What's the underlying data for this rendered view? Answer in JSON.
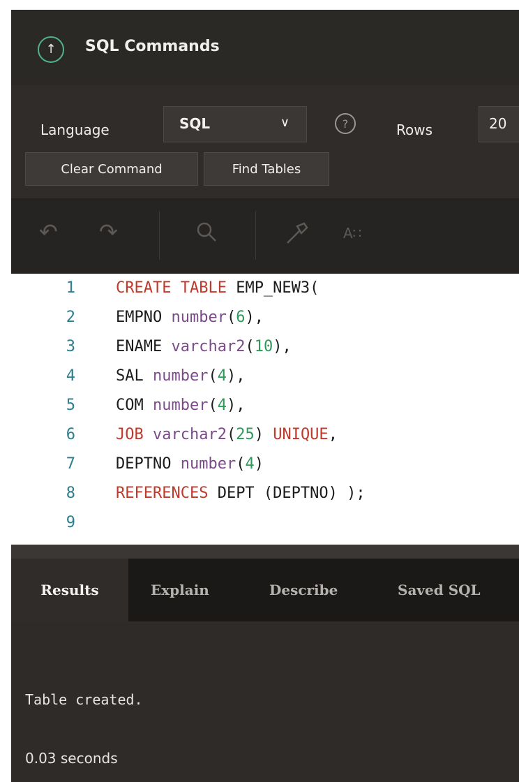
{
  "header": {
    "title": "SQL Commands",
    "icon": "arrow-up-circle-icon"
  },
  "toolbar": {
    "language_label": "Language",
    "language_value": "SQL",
    "rows_label": "Rows",
    "rows_value": "20",
    "clear_label": "Clear Command",
    "find_label": "Find Tables",
    "format_label": "A∷"
  },
  "editor": {
    "lines": [
      {
        "n": "1"
      },
      {
        "n": "2"
      },
      {
        "n": "3"
      },
      {
        "n": "4"
      },
      {
        "n": "5"
      },
      {
        "n": "6"
      },
      {
        "n": "7"
      },
      {
        "n": "8"
      },
      {
        "n": "9"
      }
    ],
    "code": {
      "l1a": "CREATE TABLE",
      "l1b": " EMP_NEW3(",
      "l2a": "EMPNO ",
      "l2b": "number",
      "l2c": "(",
      "l2d": "6",
      "l2e": "),",
      "l3a": "ENAME ",
      "l3b": "varchar2",
      "l3c": "(",
      "l3d": "10",
      "l3e": "),",
      "l4a": "SAL ",
      "l4b": "number",
      "l4c": "(",
      "l4d": "4",
      "l4e": "),",
      "l5a": "COM ",
      "l5b": "number",
      "l5c": "(",
      "l5d": "4",
      "l5e": "),",
      "l6a": "JOB ",
      "l6b": "varchar2",
      "l6c": "(",
      "l6d": "25",
      "l6e": ") ",
      "l6f": "UNIQUE",
      "l6g": ",",
      "l7a": "DEPTNO ",
      "l7b": "number",
      "l7c": "(",
      "l7d": "4",
      "l7e": ")",
      "l8a": "REFERENCES",
      "l8b": " DEPT (DEPTNO) );"
    }
  },
  "tabs": [
    {
      "label": "Results"
    },
    {
      "label": "Explain"
    },
    {
      "label": "Describe"
    },
    {
      "label": "Saved SQL"
    }
  ],
  "results": {
    "message": "Table created.",
    "time": "0.03 seconds"
  },
  "colors": {
    "accent": "#4fb38c",
    "keyword": "#c0392b",
    "type": "#7b4a88",
    "number": "#2e9a5a",
    "line_number": "#2a7e8f"
  }
}
